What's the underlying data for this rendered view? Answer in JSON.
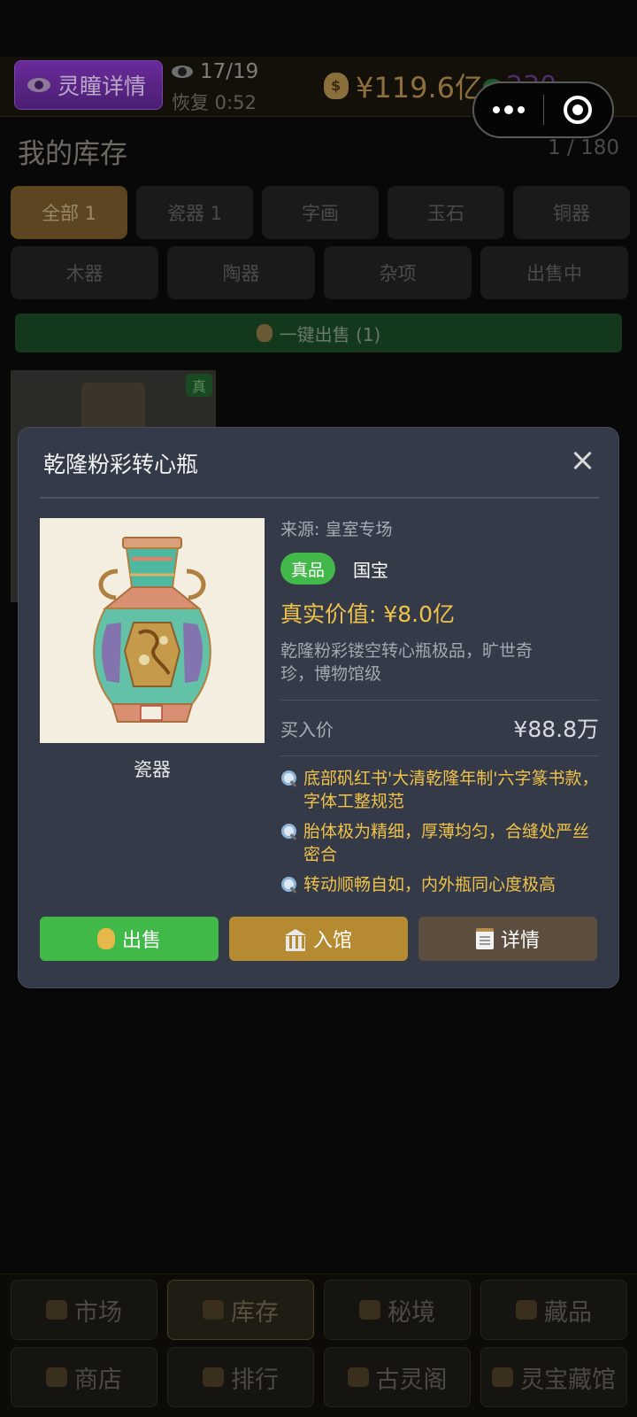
{
  "topbar": {
    "eye_button_label": "灵瞳详情",
    "eye_count": "17/19",
    "recover_text": "恢复 0:52",
    "coins": "¥119.6亿",
    "jade": "230"
  },
  "inventory": {
    "title": "我的库存",
    "count": "1 / 180",
    "tabs_row1": [
      "全部 1",
      "瓷器 1",
      "字画",
      "玉石",
      "铜器"
    ],
    "tabs_row2": [
      "木器",
      "陶器",
      "杂项",
      "出售中"
    ],
    "sell_all_label": "一键出售 (1)",
    "card_badge": "真"
  },
  "modal": {
    "title": "乾隆粉彩转心瓶",
    "source": "来源: 皇室专场",
    "tag_real": "真品",
    "tag_grade": "国宝",
    "true_value": "真实价值: ¥8.0亿",
    "description": "乾隆粉彩镂空转心瓶极品，旷世奇珍，博物馆级",
    "image_caption": "瓷器",
    "buy_label": "买入价",
    "buy_value": "¥88.8万",
    "clues": [
      "底部矾红书'大清乾隆年制'六字篆书款，字体工整规范",
      "胎体极为精细，厚薄均匀，合缝处严丝密合",
      "转动顺畅自如，内外瓶同心度极高"
    ],
    "actions": {
      "sell": "出售",
      "museum": "入馆",
      "detail": "详情"
    }
  },
  "bottom_nav": [
    "市场",
    "库存",
    "秘境",
    "藏品",
    "商店",
    "排行",
    "古灵阁",
    "灵宝藏馆"
  ],
  "colors": {
    "accent_gold": "#f0c24a",
    "real_green": "#42b84a",
    "modal_bg": "#343a47",
    "museum_btn": "#b68a30",
    "detail_btn": "#5d4f40"
  }
}
